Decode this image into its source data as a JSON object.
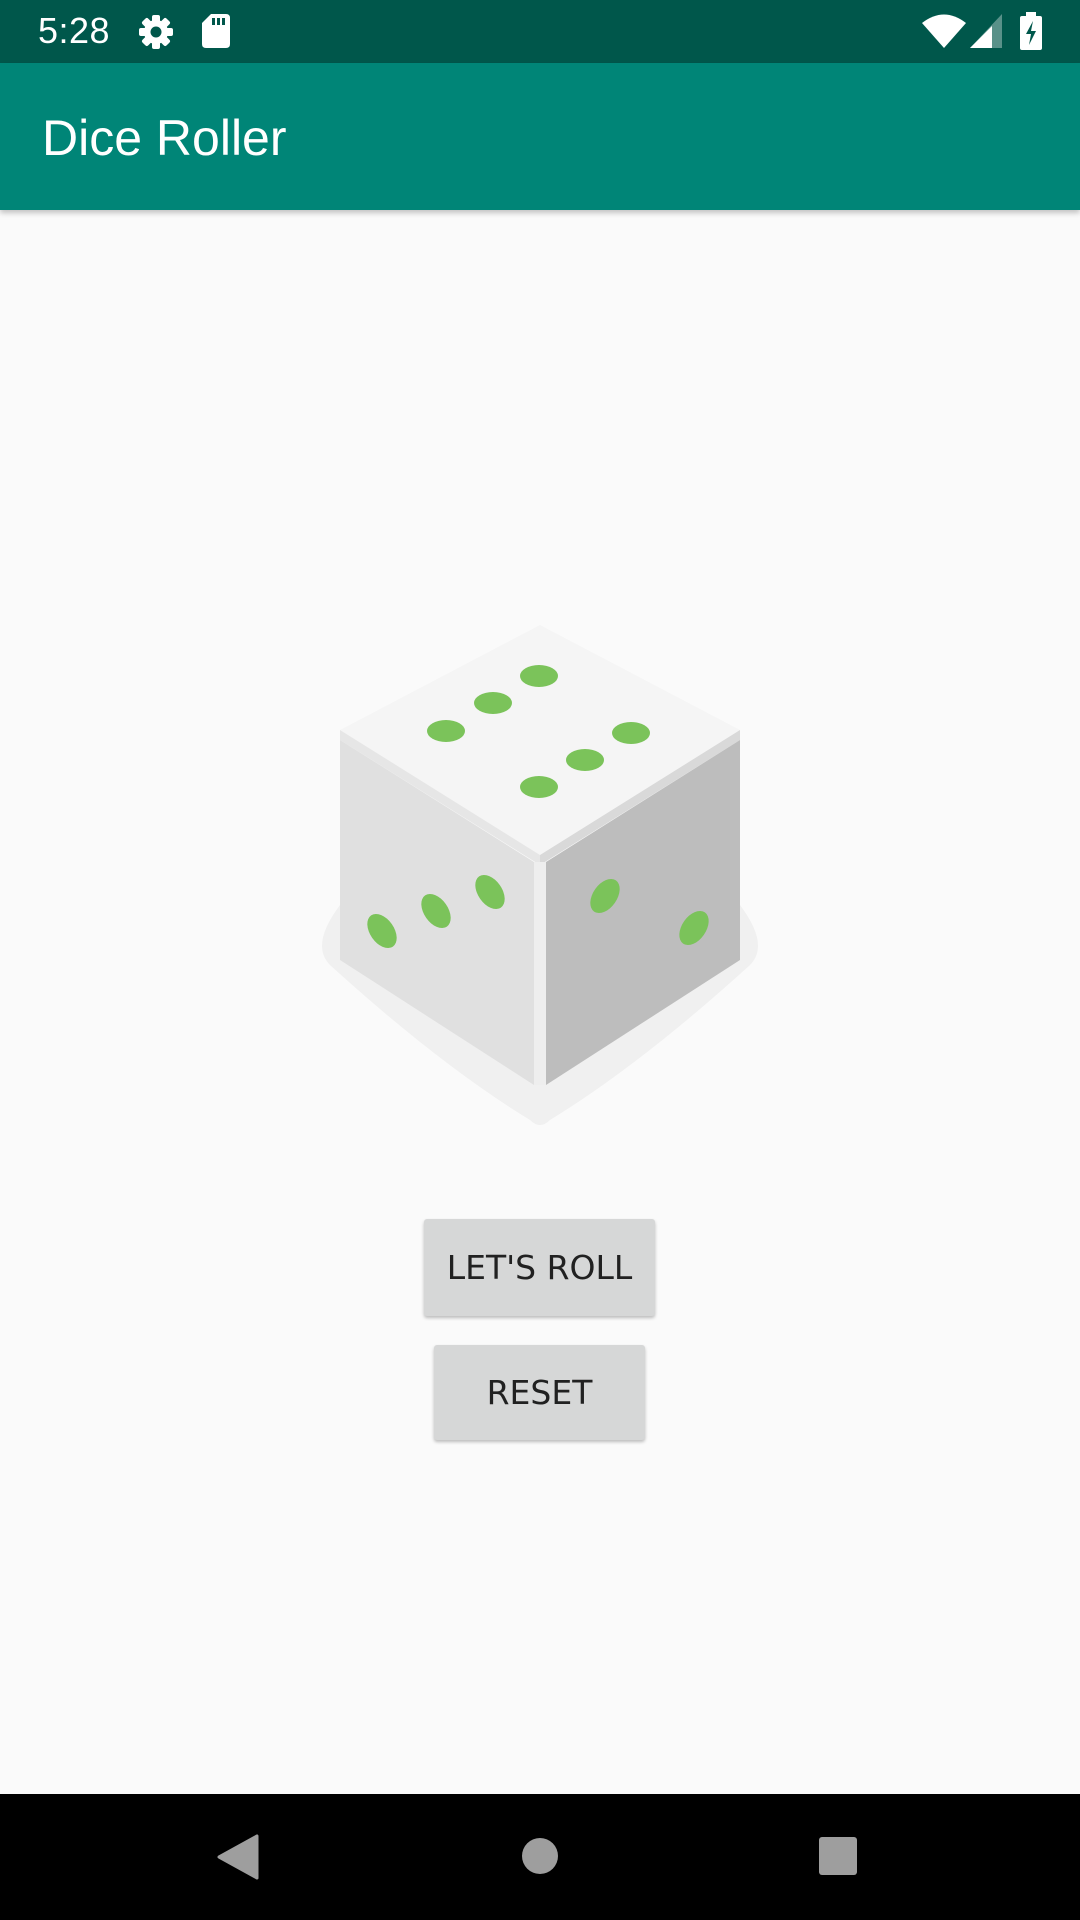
{
  "status_bar": {
    "time": "5:28",
    "icons": [
      "settings-icon",
      "sd-card-icon",
      "wifi-icon",
      "cell-signal-icon",
      "battery-charging-icon"
    ]
  },
  "app_bar": {
    "title": "Dice Roller"
  },
  "dice": {
    "icon": "dice-icon",
    "top_pips": 6,
    "left_pips": 3,
    "right_pips": 2,
    "pip_color": "#7bc35a"
  },
  "buttons": {
    "roll_label": "LET'S ROLL",
    "reset_label": "RESET"
  },
  "nav_bar": {
    "icons": [
      "back-icon",
      "home-icon",
      "recents-icon"
    ]
  },
  "colors": {
    "status_bar": "#00574b",
    "app_bar": "#008577",
    "background": "#fafafa",
    "button": "#d6d7d7"
  }
}
